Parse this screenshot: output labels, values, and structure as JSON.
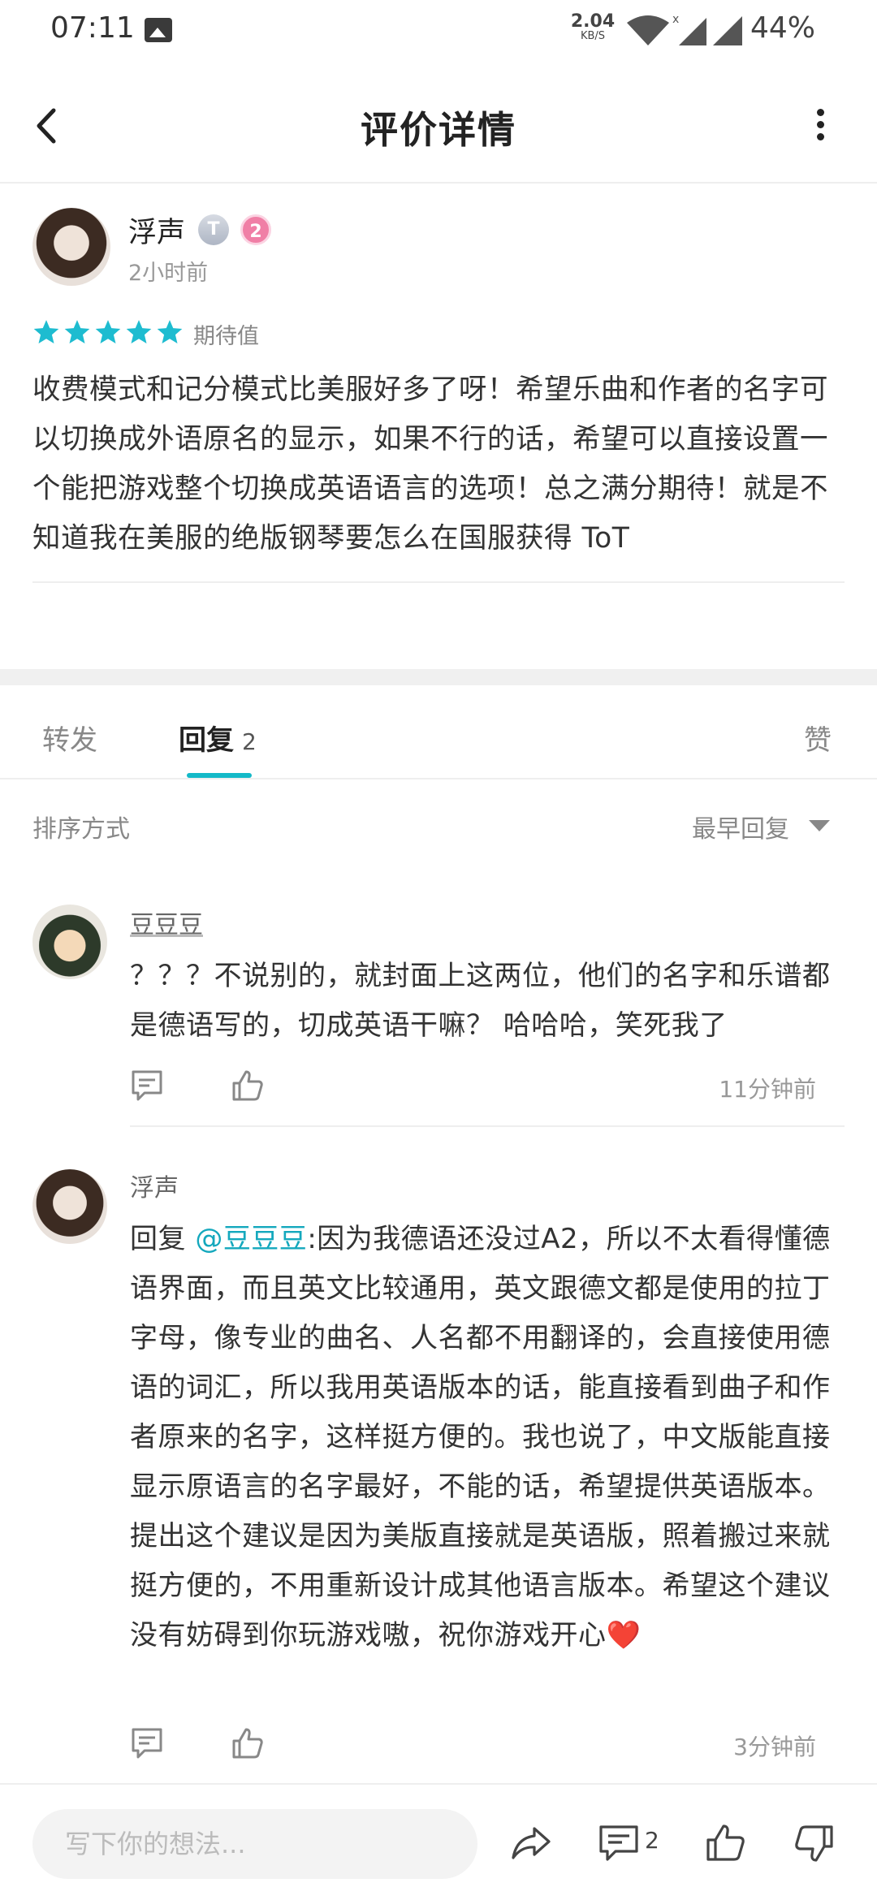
{
  "status_bar": {
    "time": "07:11",
    "net_speed_value": "2.04",
    "net_speed_unit": "KB/S",
    "battery": "44%"
  },
  "header": {
    "title": "评价详情",
    "back_icon": "chevron-left-icon",
    "more_icon": "more-vertical-icon"
  },
  "review": {
    "author": "浮声",
    "badge_t": "T",
    "badge_level": "2",
    "time": "2小时前",
    "stars": 5,
    "star_color": "#1ebcd0",
    "rating_label": "期待值",
    "body": "收费模式和记分模式比美服好多了呀！希望乐曲和作者的名字可以切换成外语原名的显示，如果不行的话，希望可以直接设置一个能把游戏整个切换成英语语言的选项！总之满分期待！就是不知道我在美服的绝版钢琴要怎么在国服获得 ToT"
  },
  "tabs": {
    "forward": "转发",
    "reply": "回复",
    "reply_count": "2",
    "like": "赞",
    "active_color": "#14b9c8"
  },
  "sort": {
    "label": "排序方式",
    "value": "最早回复"
  },
  "replies": [
    {
      "name": "豆豆豆",
      "body": "？？？不说别的，就封面上这两位，他们的名字和乐谱都是德语写的，切成英语干嘛？ 哈哈哈，笑死我了",
      "time": "11分钟前"
    },
    {
      "name": "浮声",
      "reply_prefix": " 回复 ",
      "mention": "@豆豆豆",
      "body": ":因为我德语还没过A2，所以不太看得懂德语界面，而且英文比较通用，英文跟德文都是使用的拉丁字母，像专业的曲名、人名都不用翻译的，会直接使用德语的词汇，所以我用英语版本的话，能直接看到曲子和作者原来的名字，这样挺方便的。我也说了，中文版能直接显示原语言的名字最好，不能的话，希望提供英语版本。提出这个建议是因为美版直接就是英语版，照着搬过来就挺方便的，不用重新设计成其他语言版本。希望这个建议没有妨碍到你玩游戏嗷，祝你游戏开心",
      "emoji": "❤️",
      "time": "3分钟前"
    }
  ],
  "bottom_bar": {
    "input_placeholder": "写下你的想法...",
    "comment_count": "2"
  }
}
